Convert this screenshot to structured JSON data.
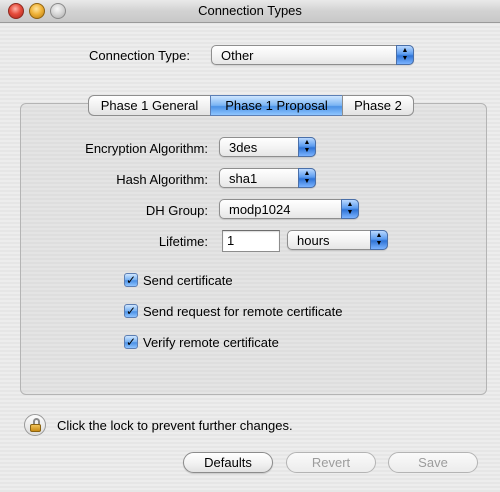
{
  "window": {
    "title": "Connection Types"
  },
  "connection_type": {
    "label": "Connection Type:",
    "value": "Other"
  },
  "tabs": [
    {
      "label": "Phase 1 General",
      "active": false
    },
    {
      "label": "Phase 1 Proposal",
      "active": true
    },
    {
      "label": "Phase 2",
      "active": false
    }
  ],
  "form": {
    "encryption": {
      "label": "Encryption Algorithm:",
      "value": "3des"
    },
    "hash": {
      "label": "Hash Algorithm:",
      "value": "sha1"
    },
    "dh_group": {
      "label": "DH Group:",
      "value": "modp1024"
    },
    "lifetime": {
      "label": "Lifetime:",
      "value": "1",
      "unit": "hours"
    }
  },
  "checkboxes": [
    {
      "label": "Send certificate",
      "checked": true
    },
    {
      "label": "Send request for remote certificate",
      "checked": true
    },
    {
      "label": "Verify remote certificate",
      "checked": true
    }
  ],
  "lock": {
    "text": "Click the lock to prevent further changes.",
    "icon": "lock-icon"
  },
  "buttons": {
    "defaults": "Defaults",
    "revert": "Revert",
    "save": "Save"
  },
  "colors": {
    "accent": "#4a8fe4"
  }
}
